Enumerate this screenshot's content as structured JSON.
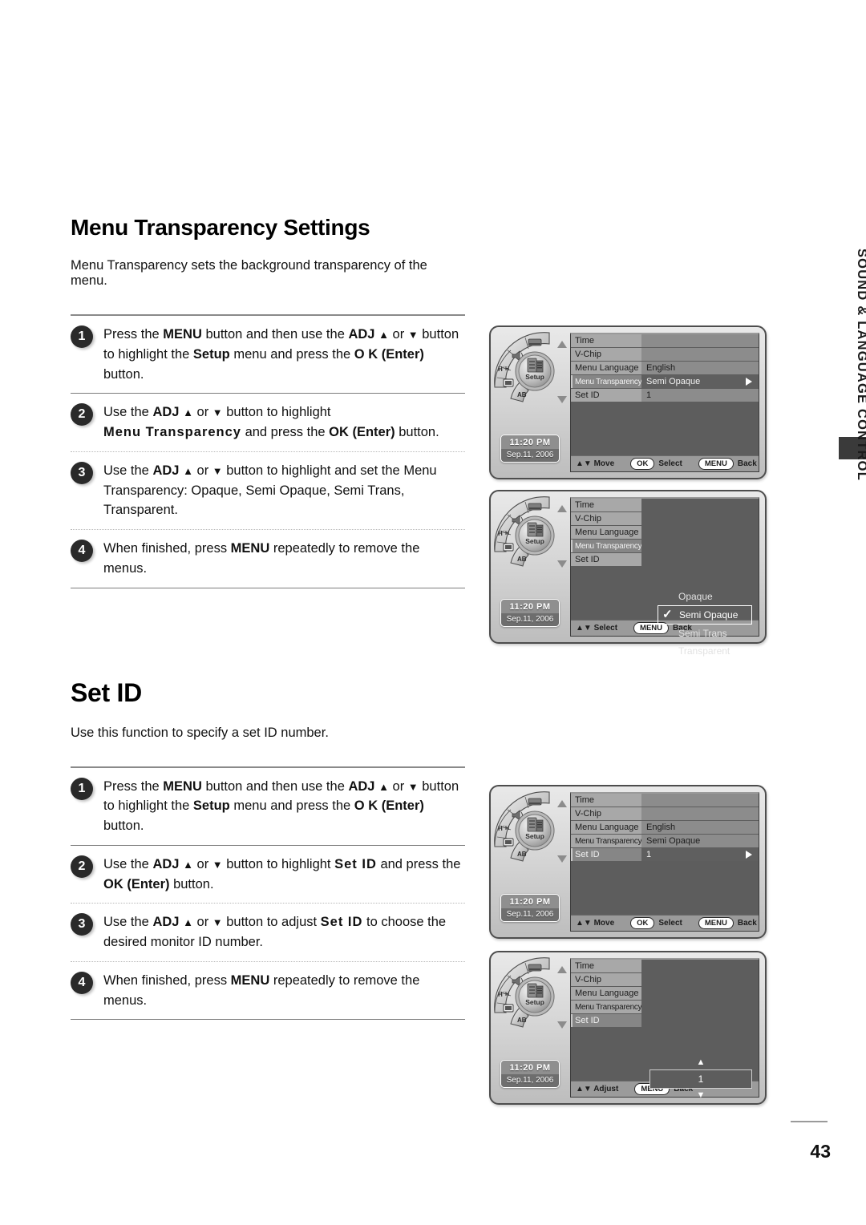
{
  "sections": [
    {
      "title": "Menu Transparency Settings",
      "desc": "Menu Transparency sets the background transparency of the menu.",
      "steps": [
        {
          "n": "1",
          "html": "Press the <b>MENU</b> button and then use the <b>ADJ</b> <span class=\"tri\">▲</span> or <span class=\"tri\">▼</span> button to highlight the <b>Setup</b> menu and press the <b>O K</b> <b>(Enter)</b> button."
        },
        {
          "n": "2",
          "html": "Use the <b>ADJ</b> <span class=\"tri\">▲</span> or <span class=\"tri\">▼</span> button to highlight<br><span class=\"sp\">Menu Transparency</span> and press the <b>OK (Enter)</b> button."
        },
        {
          "n": "3",
          "html": "Use the <b>ADJ</b> <span class=\"tri\">▲</span> or <span class=\"tri\">▼</span> button to highlight and set the Menu Transparency: Opaque, Semi Opaque, Semi Trans, Transparent."
        },
        {
          "n": "4",
          "html": "When finished, press <b>MENU</b> repeatedly to remove the menus."
        }
      ]
    },
    {
      "title": "Set ID",
      "desc": "Use this function to specify a set ID number.",
      "steps": [
        {
          "n": "1",
          "html": "Press the <b>MENU</b> button and then use the <b>ADJ</b> <span class=\"tri\">▲</span> or <span class=\"tri\">▼</span> button to highlight the <b>Setup</b> menu and press the <b>O K</b> <b>(Enter)</b> button."
        },
        {
          "n": "2",
          "html": "Use the <b>ADJ</b> <span class=\"tri\">▲</span> or <span class=\"tri\">▼</span> button to highlight <span class=\"sp\">Set ID</span> and press the <b>OK (Enter)</b> button."
        },
        {
          "n": "3",
          "html": "Use the <b>ADJ</b> <span class=\"tri\">▲</span> or <span class=\"tri\">▼</span> button to adjust <span class=\"sp\">Set ID</span> to choose the desired monitor ID number."
        },
        {
          "n": "4",
          "html": "When finished, press <b>MENU</b> repeatedly to remove the menus."
        }
      ]
    }
  ],
  "osd_common": {
    "dial_label": "Setup",
    "dial_segments": [
      "picture-icon",
      "sound-icon",
      "H-icon",
      "tv-icon",
      "AB"
    ],
    "clock_time": "11:20 PM",
    "clock_date": "Sep.11, 2006"
  },
  "screens": [
    {
      "id": "screen-menu-transparency-selected",
      "rows": [
        {
          "label": "Time",
          "value": "",
          "selected": false
        },
        {
          "label": "V-Chip",
          "value": "",
          "selected": false
        },
        {
          "label": "Menu Language",
          "value": "English",
          "selected": false
        },
        {
          "label": "Menu Transparency",
          "value": "Semi Opaque",
          "selected": true
        },
        {
          "label": "Set ID",
          "value": "1",
          "selected": false
        }
      ],
      "bar": {
        "nav": "▲▼ Move",
        "ok_pill": "OK",
        "ok_label": "Select",
        "menu_pill": "MENU",
        "menu_label": "Back"
      }
    },
    {
      "id": "screen-transparency-options",
      "rows": [
        {
          "label": "Time",
          "value": null,
          "selected": false
        },
        {
          "label": "V-Chip",
          "value": null,
          "selected": false
        },
        {
          "label": "Menu Language",
          "value": null,
          "selected": false
        },
        {
          "label": "Menu Transparency",
          "value": null,
          "selected": true
        },
        {
          "label": "Set ID",
          "value": null,
          "selected": false
        }
      ],
      "options": [
        {
          "label": "Opaque",
          "checked": false
        },
        {
          "label": "Semi Opaque",
          "checked": true
        },
        {
          "label": "Semi Trans",
          "checked": false
        },
        {
          "label": "Transparent",
          "checked": false
        }
      ],
      "bar": {
        "nav": "▲▼ Select",
        "ok_pill": null,
        "ok_label": null,
        "menu_pill": "MENU",
        "menu_label": "Back"
      }
    },
    {
      "id": "screen-set-id-selected",
      "rows": [
        {
          "label": "Time",
          "value": "",
          "selected": false
        },
        {
          "label": "V-Chip",
          "value": "",
          "selected": false
        },
        {
          "label": "Menu Language",
          "value": "English",
          "selected": false
        },
        {
          "label": "Menu Transparency",
          "value": "Semi Opaque",
          "selected": false
        },
        {
          "label": "Set ID",
          "value": "1",
          "selected": true
        }
      ],
      "bar": {
        "nav": "▲▼ Move",
        "ok_pill": "OK",
        "ok_label": "Select",
        "menu_pill": "MENU",
        "menu_label": "Back"
      }
    },
    {
      "id": "screen-set-id-adjust",
      "rows": [
        {
          "label": "Time",
          "value": null,
          "selected": false
        },
        {
          "label": "V-Chip",
          "value": null,
          "selected": false
        },
        {
          "label": "Menu Language",
          "value": null,
          "selected": false
        },
        {
          "label": "Menu Transparency",
          "value": null,
          "selected": false
        },
        {
          "label": "Set ID",
          "value": null,
          "selected": true
        }
      ],
      "stepper": {
        "up": "▲",
        "value": "1",
        "down": "▼"
      },
      "bar": {
        "nav": "▲▼ Adjust",
        "ok_pill": null,
        "ok_label": null,
        "menu_pill": "MENU",
        "menu_label": "Back"
      }
    }
  ],
  "side_tab": {
    "label": "SOUND & LANGUAGE CONTROL"
  },
  "footer": {
    "page_number": "43"
  },
  "colors": {
    "osd_bg": "#5d5d5d",
    "osd_label": "#a8a8a8",
    "osd_value": "#8c8c8c",
    "osd_bar": "#9b9b9b",
    "badge": "#2a2a2a",
    "side_tab": "#3a3a3a"
  }
}
